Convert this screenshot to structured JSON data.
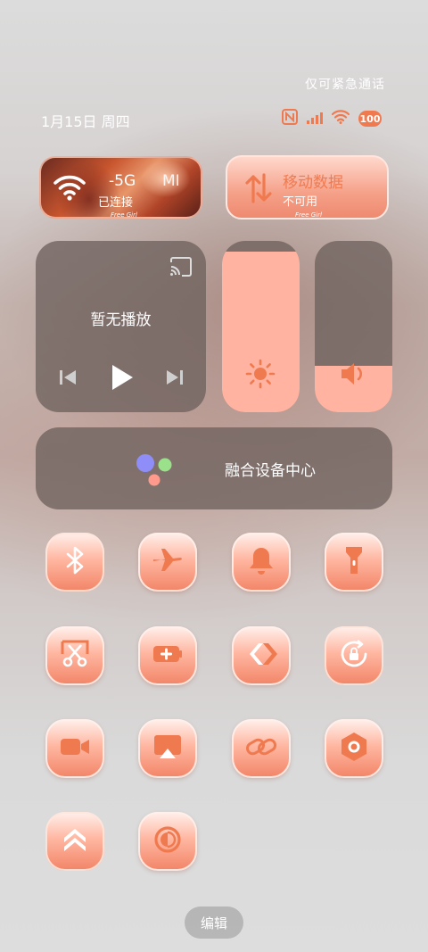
{
  "status": {
    "emergency_text": "仅可紧急通话",
    "date": "1月15日 周四",
    "battery": "100",
    "icons": [
      "nfc-icon",
      "signal-icon",
      "wifi-icon",
      "battery-icon"
    ]
  },
  "wifi": {
    "name": "-5G",
    "name_suffix": "MI",
    "status": "已连接",
    "wallpaper_tag": "Free Girl"
  },
  "mobile_data": {
    "title": "移动数据",
    "status": "不可用",
    "wallpaper_tag": "Free Girl"
  },
  "media": {
    "text": "暂无播放",
    "icons": [
      "cast-icon",
      "previous-icon",
      "play-icon",
      "next-icon"
    ]
  },
  "sliders": {
    "brightness_level": 0.94,
    "volume_level": 0.27
  },
  "fusion": {
    "label": "融合设备中心"
  },
  "tiles": [
    {
      "name": "bluetooth",
      "icon": "bluetooth-icon"
    },
    {
      "name": "airplane-mode",
      "icon": "airplane-icon"
    },
    {
      "name": "ringer",
      "icon": "bell-icon"
    },
    {
      "name": "flashlight",
      "icon": "flashlight-icon"
    },
    {
      "name": "screenshot",
      "icon": "scissors-icon"
    },
    {
      "name": "battery-saver",
      "icon": "battery-plus-icon"
    },
    {
      "name": "nearby-share",
      "icon": "share-arrows-icon"
    },
    {
      "name": "rotation-lock",
      "icon": "rotation-lock-icon"
    },
    {
      "name": "screen-record",
      "icon": "video-camera-icon"
    },
    {
      "name": "screen-cast",
      "icon": "airplay-icon"
    },
    {
      "name": "hotspot-link",
      "icon": "link-icon"
    },
    {
      "name": "settings",
      "icon": "hexagon-icon"
    },
    {
      "name": "performance-mode",
      "icon": "chevrons-up-icon"
    },
    {
      "name": "dark-mode",
      "icon": "contrast-icon"
    }
  ],
  "colors": {
    "accent": "#f07a50",
    "tile_light": "#ffb7a2",
    "panel": "#6e625e"
  },
  "edit_label": "编辑"
}
